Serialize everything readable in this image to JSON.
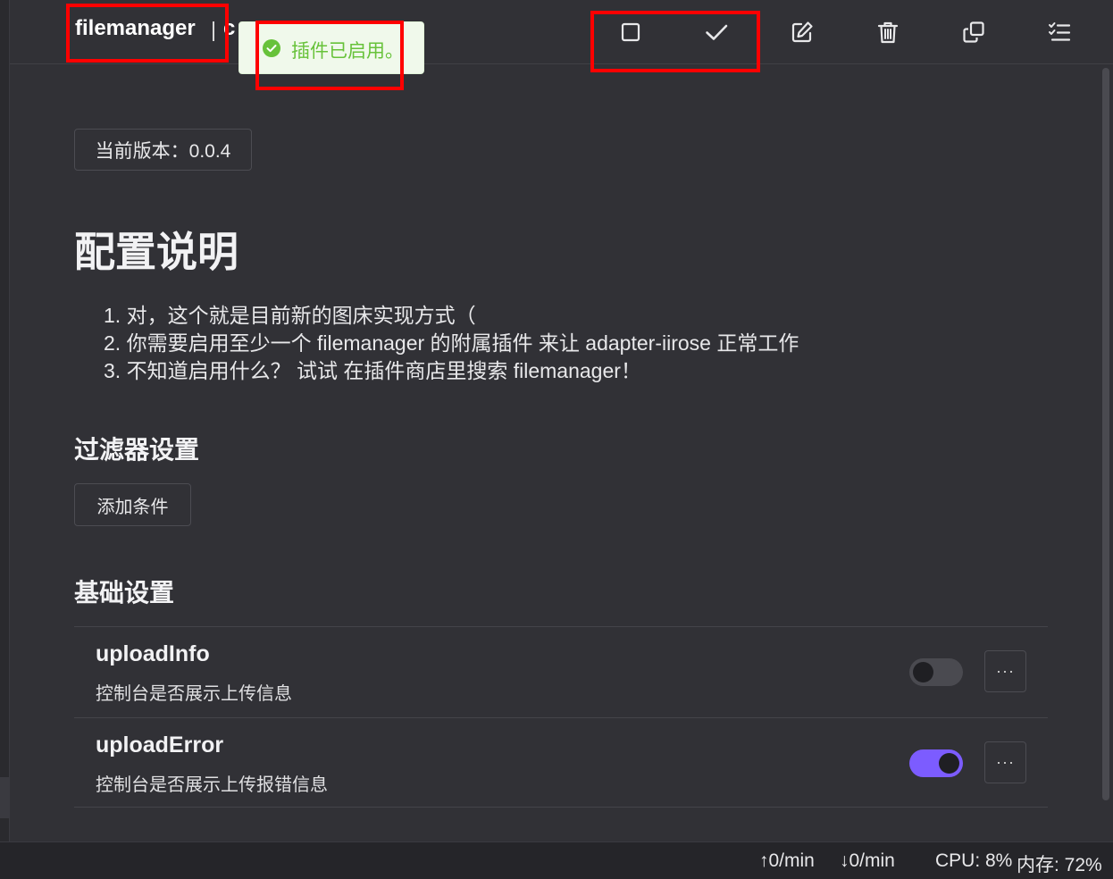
{
  "header": {
    "plugin_name": "filemanager",
    "plugin_name_rest": "c"
  },
  "toast": {
    "icon": "check-circle-icon",
    "message": "插件已启用。",
    "color": "#67c23a"
  },
  "toolbar": {
    "buttons": [
      {
        "name": "stop-button",
        "icon": "square-icon"
      },
      {
        "name": "enable-button",
        "icon": "check-icon"
      },
      {
        "name": "edit-button",
        "icon": "edit-icon"
      },
      {
        "name": "delete-button",
        "icon": "trash-icon"
      },
      {
        "name": "copy-button",
        "icon": "copy-icon"
      },
      {
        "name": "list-button",
        "icon": "checklist-icon"
      }
    ]
  },
  "main": {
    "version_label": "当前版本：0.0.4",
    "title": "配置说明",
    "description": [
      "1. 对，这个就是目前新的图床实现方式（",
      "2. 你需要启用至少一个 filemanager 的附属插件 来让 adapter-iirose 正常工作",
      "3. 不知道启用什么？ 试试 在插件商店里搜索 filemanager！"
    ],
    "filter_section_title": "过滤器设置",
    "add_condition_label": "添加条件",
    "basic_section_title": "基础设置",
    "settings": [
      {
        "key": "uploadInfo",
        "hint": "控制台是否展示上传信息",
        "enabled": false,
        "more_label": "···"
      },
      {
        "key": "uploadError",
        "hint": "控制台是否展示上传报错信息",
        "enabled": true,
        "more_label": "···"
      }
    ],
    "accent_color": "#7c5cff"
  },
  "statusbar": {
    "upload_rate": "0/min",
    "download_rate": "0/min",
    "cpu": "CPU: 8%",
    "memory": "内存: 72%"
  }
}
